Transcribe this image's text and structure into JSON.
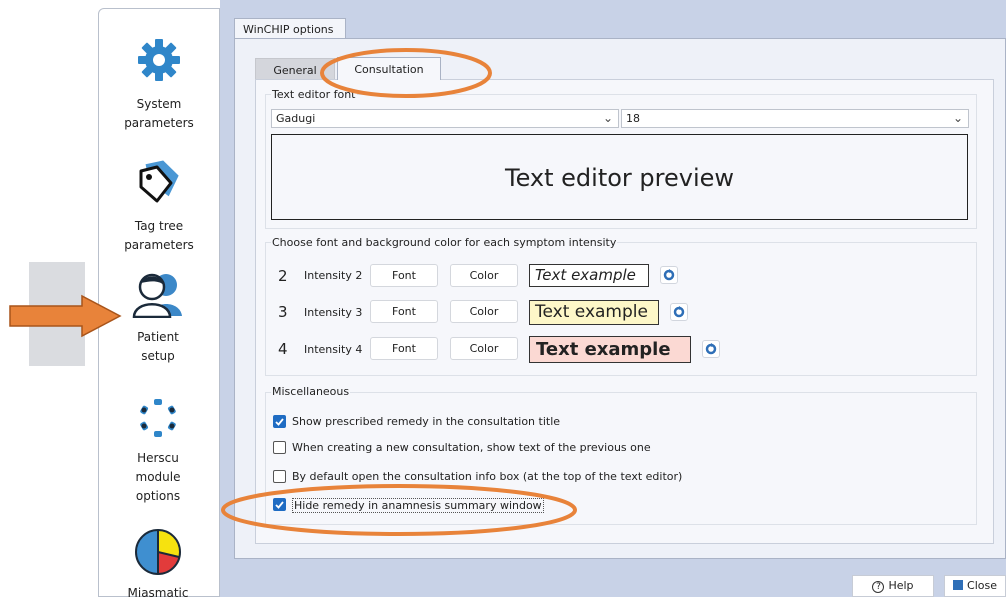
{
  "sidebar": {
    "items": [
      {
        "label_line1": "System",
        "label_line2": "parameters",
        "icon": "gear-icon"
      },
      {
        "label_line1": "Tag tree",
        "label_line2": "parameters",
        "icon": "tag-icon"
      },
      {
        "label_line1": "Patient",
        "label_line2": "setup",
        "icon": "patients-icon"
      },
      {
        "label_line1": "Herscu",
        "label_line2": "module",
        "label_line3": "options",
        "icon": "dots-ring-icon"
      },
      {
        "label_line1": "Miasmatic",
        "icon": "pie-icon"
      }
    ]
  },
  "window": {
    "tab": "WinCHIP options"
  },
  "tabs": {
    "general": "General",
    "consultation": "Consultation"
  },
  "text_editor_font": {
    "title": "Text editor font",
    "font_value": "Gadugi",
    "size_value": "18",
    "preview": "Text editor preview"
  },
  "intensity": {
    "title": "Choose font and background color for each symptom intensity",
    "rows": [
      {
        "num": "2",
        "label": "Intensity 2",
        "font_btn": "Font",
        "color_btn": "Color",
        "sample": "Text example"
      },
      {
        "num": "3",
        "label": "Intensity 3",
        "font_btn": "Font",
        "color_btn": "Color",
        "sample": "Text example"
      },
      {
        "num": "4",
        "label": "Intensity 4",
        "font_btn": "Font",
        "color_btn": "Color",
        "sample": "Text example"
      }
    ]
  },
  "misc": {
    "title": "Miscellaneous",
    "options": [
      {
        "label": "Show prescribed remedy in the consultation title",
        "checked": true
      },
      {
        "label": "When creating a new consultation, show text of the previous one",
        "checked": false
      },
      {
        "label": "By default open the consultation info box (at the top of the text editor)",
        "checked": false
      },
      {
        "label": "Hide remedy in anamnesis summary window",
        "checked": true
      }
    ]
  },
  "footer": {
    "help": "Help",
    "close": "Close"
  },
  "colors": {
    "accent": "#1f6cc3",
    "annotation": "#e8833a",
    "intensity3_bg": "#fdf7c8",
    "intensity4_bg": "#fbd9d3"
  }
}
